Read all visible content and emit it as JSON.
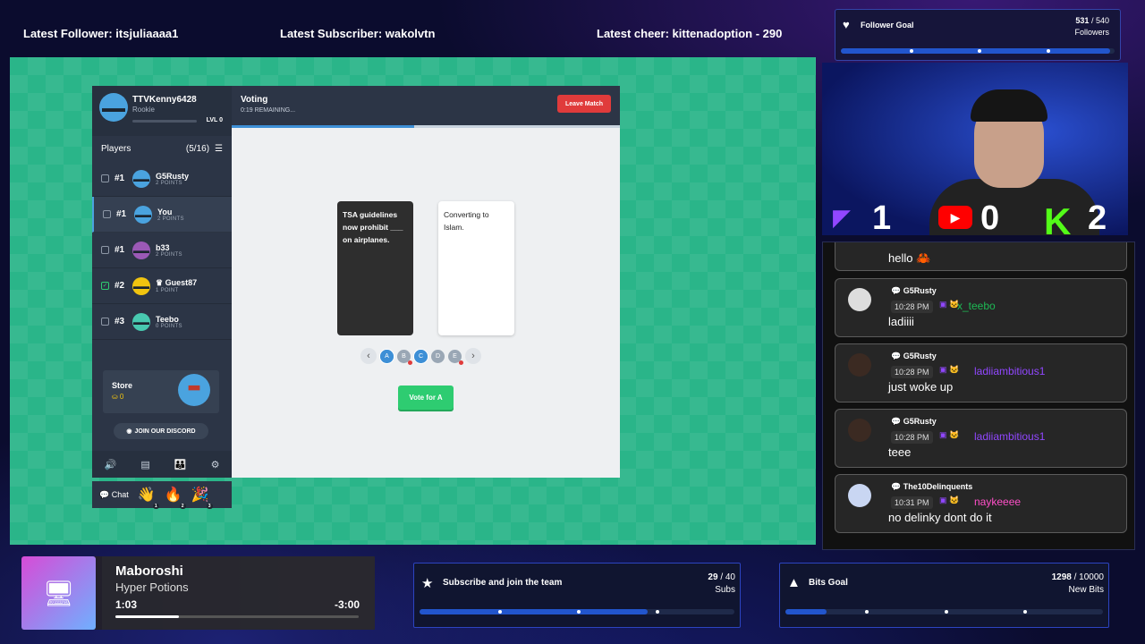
{
  "topbar": {
    "follower": "Latest Follower: itsjuliaaaa1",
    "subscriber": "Latest Subscriber: wakolvtn",
    "cheer": "Latest cheer: kittenadoption - 290"
  },
  "game": {
    "profile": {
      "name": "TTVKenny6428",
      "rank": "Rookie",
      "level": "LVL 0"
    },
    "players_header": {
      "label": "Players",
      "count": "(5/16)"
    },
    "players": [
      {
        "rank": "#1",
        "name": "G5Rusty",
        "points": "2 POINTS",
        "color": "#4aa3df",
        "checked": false,
        "me": false
      },
      {
        "rank": "#1",
        "name": "You",
        "points": "2 POINTS",
        "color": "#4aa3df",
        "checked": false,
        "me": true
      },
      {
        "rank": "#1",
        "name": "b33",
        "points": "2 POINTS",
        "color": "#9b59b6",
        "checked": false,
        "me": false
      },
      {
        "rank": "#2",
        "name": "♛ Guest87",
        "points": "1 POINT",
        "color": "#f1c40f",
        "checked": true,
        "me": false
      },
      {
        "rank": "#3",
        "name": "Teebo",
        "points": "0 POINTS",
        "color": "#48c9b0",
        "checked": false,
        "me": false
      }
    ],
    "store": {
      "label": "Store",
      "coins": "⛀ 0"
    },
    "discord": "JOIN OUR DISCORD",
    "chat_label": "Chat",
    "reactions": [
      {
        "emoji": "👋",
        "count": "1"
      },
      {
        "emoji": "🔥",
        "count": "2"
      },
      {
        "emoji": "🎉",
        "count": "3"
      }
    ],
    "match": {
      "title": "Voting",
      "remaining": "0:19 REMAINING...",
      "leave": "Leave Match",
      "progress": 0.47
    },
    "black_card": "TSA guidelines now prohibit ___ on airplanes.",
    "white_card": "Converting to Islam.",
    "options": [
      "A",
      "B",
      "C",
      "D",
      "E"
    ],
    "vote_button": "Vote for A"
  },
  "follower_goal": {
    "title": "Follower Goal",
    "current": "531",
    "target": "/ 540",
    "unit": "Followers",
    "progress": 0.983
  },
  "scoreboard": {
    "twitch": "1",
    "youtube": "0",
    "kick": "2"
  },
  "chat": {
    "partial": "hello",
    "messages": [
      {
        "name": "G5Rusty",
        "time": "10:28 PM",
        "display": "x_teebo",
        "color": "#1db954",
        "text": "ladiiii"
      },
      {
        "name": "G5Rusty",
        "time": "10:28 PM",
        "display": "ladiiambitious1",
        "color": "#9147ff",
        "text": "just woke up"
      },
      {
        "name": "G5Rusty",
        "time": "10:28 PM",
        "display": "ladiiambitious1",
        "color": "#9147ff",
        "text": "teee"
      },
      {
        "name": "The10Delinquents",
        "time": "10:31 PM",
        "display": "naykeeee",
        "color": "#ff4fc8",
        "text": "no delinky dont do it"
      }
    ]
  },
  "music": {
    "song": "Maboroshi",
    "artist": "Hyper Potions",
    "elapsed": "1:03",
    "remaining": "-3:00",
    "progress": 0.26
  },
  "subs_goal": {
    "title": "Subscribe and join the team",
    "current": "29",
    "target": "/ 40",
    "unit": "Subs",
    "progress": 0.725
  },
  "bits_goal": {
    "title": "Bits Goal",
    "current": "1298",
    "target": "/ 10000",
    "unit": "New Bits",
    "progress": 0.13
  }
}
